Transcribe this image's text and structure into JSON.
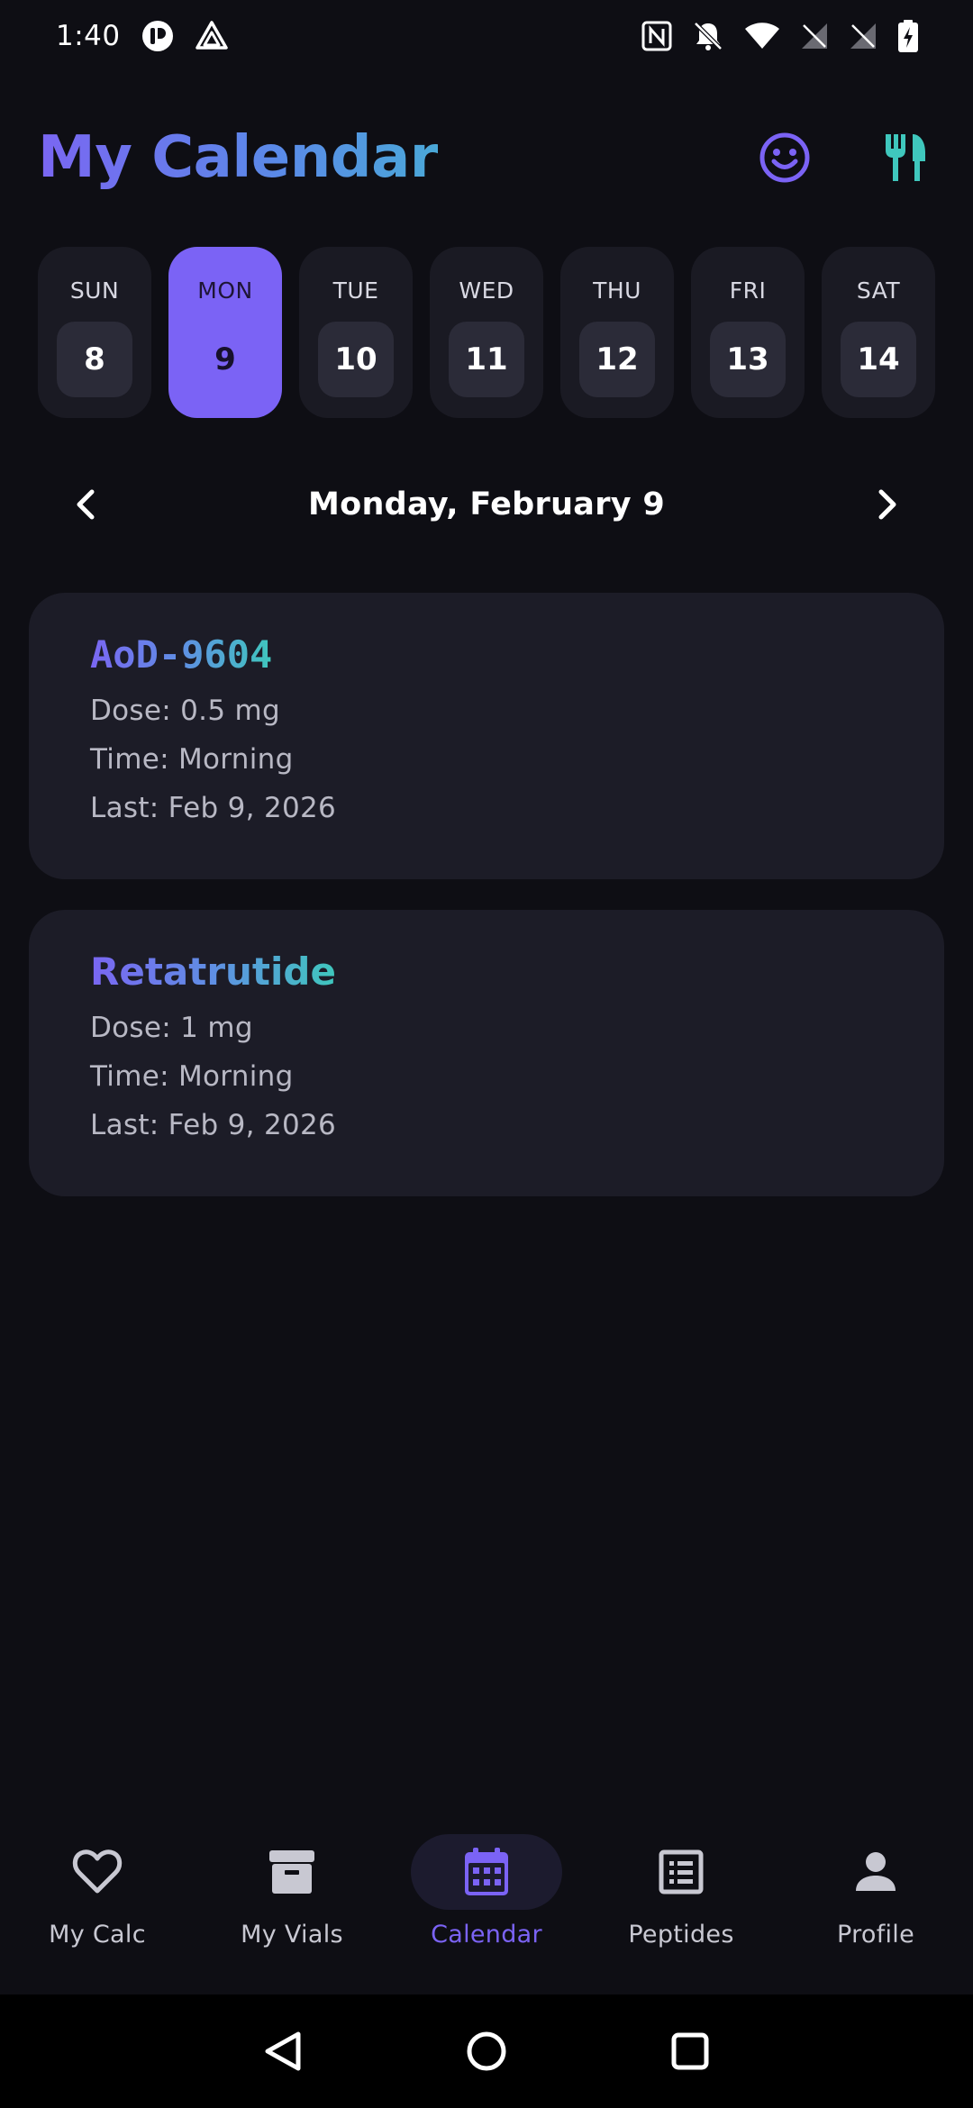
{
  "status_bar": {
    "time": "1:40",
    "icons": [
      "app-notification-icon",
      "drive-icon",
      "nfc-icon",
      "bell-muted-icon",
      "wifi-icon",
      "no-signal-icon",
      "no-signal-icon",
      "battery-charging-icon"
    ]
  },
  "header": {
    "title": "My Calendar",
    "actions": [
      "smiley-icon",
      "fork-knife-icon"
    ]
  },
  "week": {
    "days": [
      {
        "name": "SUN",
        "num": "8"
      },
      {
        "name": "MON",
        "num": "9"
      },
      {
        "name": "TUE",
        "num": "10"
      },
      {
        "name": "WED",
        "num": "11"
      },
      {
        "name": "THU",
        "num": "12"
      },
      {
        "name": "FRI",
        "num": "13"
      },
      {
        "name": "SAT",
        "num": "14"
      }
    ],
    "selected": "MON"
  },
  "date_nav": {
    "label": "Monday, February 9"
  },
  "cards": [
    {
      "title": "AoD-9604",
      "dose": "Dose: 0.5 mg",
      "time": "Time: Morning",
      "last": "Last: Feb 9, 2026"
    },
    {
      "title": "Retatrutide",
      "dose": "Dose: 1 mg",
      "time": "Time: Morning",
      "last": "Last: Feb 9, 2026"
    }
  ],
  "bottom_nav": {
    "items": [
      {
        "label": "My Calc",
        "icon": "heart-icon"
      },
      {
        "label": "My Vials",
        "icon": "archive-box-icon"
      },
      {
        "label": "Calendar",
        "icon": "calendar-icon"
      },
      {
        "label": "Peptides",
        "icon": "list-icon"
      },
      {
        "label": "Profile",
        "icon": "person-icon"
      }
    ],
    "active": "Calendar"
  },
  "colors": {
    "background": "#0e0e14",
    "accent": "#7b63f5",
    "teal": "#3fc7bd",
    "card": "#1c1c27"
  }
}
